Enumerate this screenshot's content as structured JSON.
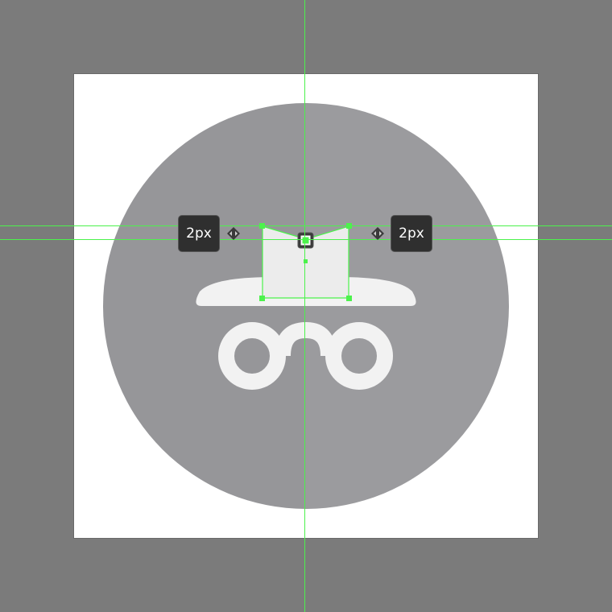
{
  "colors": {
    "workspace_bg": "#7b7b7b",
    "artboard_bg": "#ffffff",
    "circle_left": "#969699",
    "circle_right": "#9b9b9e",
    "shape_fill": "#ececec",
    "hat_fill": "#f2f2f2",
    "guide_green": "#4cf24c",
    "tooltip_bg": "#2f2f2f"
  },
  "measurements": {
    "left_label": "2px",
    "right_label": "2px"
  },
  "icons": {
    "spacing_left": "spacing-arrows-icon",
    "spacing_right": "spacing-arrows-icon",
    "incognito": "incognito-icon"
  }
}
